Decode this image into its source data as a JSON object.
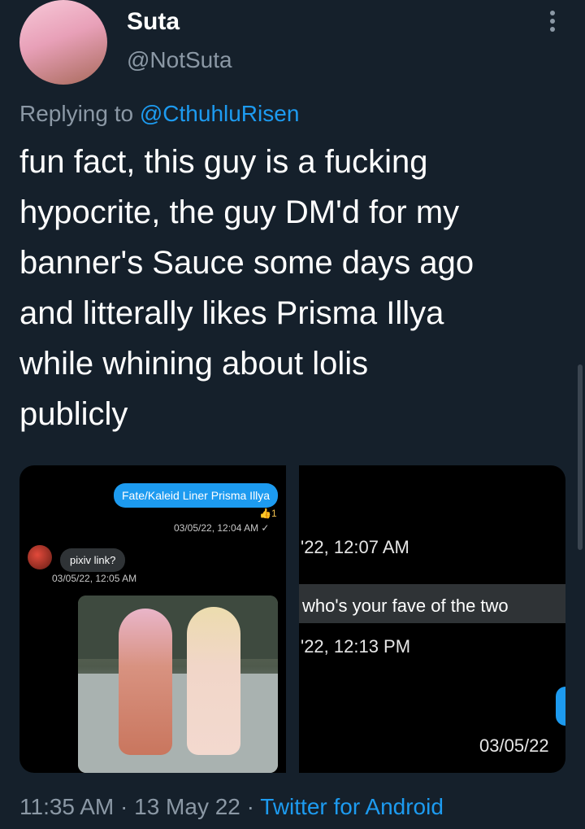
{
  "author": {
    "display_name": "Suta",
    "handle": "@NotSuta"
  },
  "reply": {
    "prefix": "Replying to",
    "mention": "@CthuhluRisen"
  },
  "tweet_text": "fun fact, this guy is a fucking\nhypocrite, the guy DM'd for my\nbanner's Sauce some days ago\nand litterally likes Prisma Illya\nwhile whining about lolis\npublicly",
  "media_1": {
    "blue_message": "Fate/Kaleid Liner Prisma Illya",
    "reaction_count": "1",
    "blue_timestamp": "03/05/22, 12:04 AM",
    "grey_message": "pixiv link?",
    "grey_timestamp": "03/05/22, 12:05 AM"
  },
  "media_2": {
    "timestamp_1": "'22, 12:07 AM",
    "message": "who's your fave of the two",
    "timestamp_2": "'22, 12:13 PM",
    "timestamp_3": "03/05/22"
  },
  "footer": {
    "time": "11:35 AM",
    "separator": "·",
    "date": "13 May 22",
    "source": "Twitter for Android"
  },
  "colors": {
    "background": "#15202b",
    "secondary_text": "#8b98a5",
    "accent": "#1d9bf0"
  }
}
